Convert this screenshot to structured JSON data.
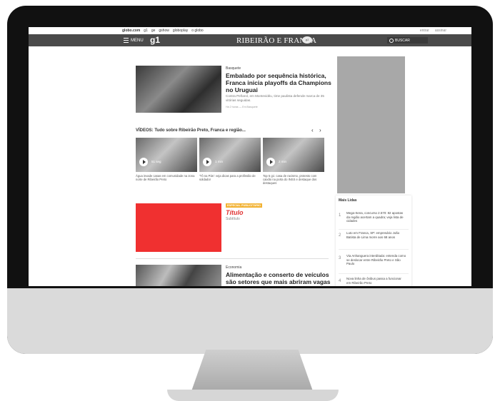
{
  "topbar": {
    "links": [
      "globo.com",
      "g1",
      "ge",
      "gshow",
      "globoplay",
      "o globo"
    ],
    "account": [
      "entrar",
      "assinar"
    ]
  },
  "header": {
    "menu_label": "MENU",
    "logo": "g1",
    "brand": "RIBEIRÃO E FRANCA",
    "search_label": "BUSCAR",
    "colors": {
      "header_bg": "#4a4a4a",
      "accent_red": "#f03030"
    }
  },
  "lead": {
    "kicker": "Basquete",
    "headline": "Embalado por sequência histórica, Franca inicia playoffs da Champions no Uruguai",
    "subtitle": "Contra Peñarol, em Montevidéu, time paulista defende marca de 35 vitórias seguidas.",
    "meta": "Há 2 horas — Em Basquete"
  },
  "videos": {
    "section_title": "VÍDEOS: Tudo sobre Ribeirão Preto, Franca e região...",
    "prev": "‹",
    "next": "›",
    "items": [
      {
        "duration": "51 seg",
        "caption": "Água invade casas em comunidade na zona norte de Ribeirão Preto"
      },
      {
        "duration": "1 min",
        "caption": "'Tô na Pás': veja dicas para a profissão de soldador"
      },
      {
        "duration": "2 min",
        "caption": "Top 5 g1: casa de racismo, protesto com caixão na porta do INSS e destaque dos destaques"
      }
    ]
  },
  "promo": {
    "badge": "ESPECIAL PUBLICITÁRIO",
    "title": "Título",
    "subtitle": "Subtítulo"
  },
  "story2": {
    "kicker": "Economia",
    "headline": "Alimentação e conserto de veículos são setores que mais abriram vagas em 2022"
  },
  "mais_lidas": {
    "title": "Mais Lidas",
    "items": [
      {
        "num": "1",
        "text": "Mega-Sena, concurso 2.570: 82 apostas da região acertam a quadra; veja lista de cidades"
      },
      {
        "num": "2",
        "text": "Luto em Franca, SP: empresário João Batista de Lima morre aos 68 anos"
      },
      {
        "num": "3",
        "text": "Via Anhanguera interditada: entenda como se deslocar entre Ribeirão Preto e São Paulo"
      },
      {
        "num": "4",
        "text": "Nova linha de ônibus passa a funcionar em Ribeirão Preto"
      }
    ]
  }
}
